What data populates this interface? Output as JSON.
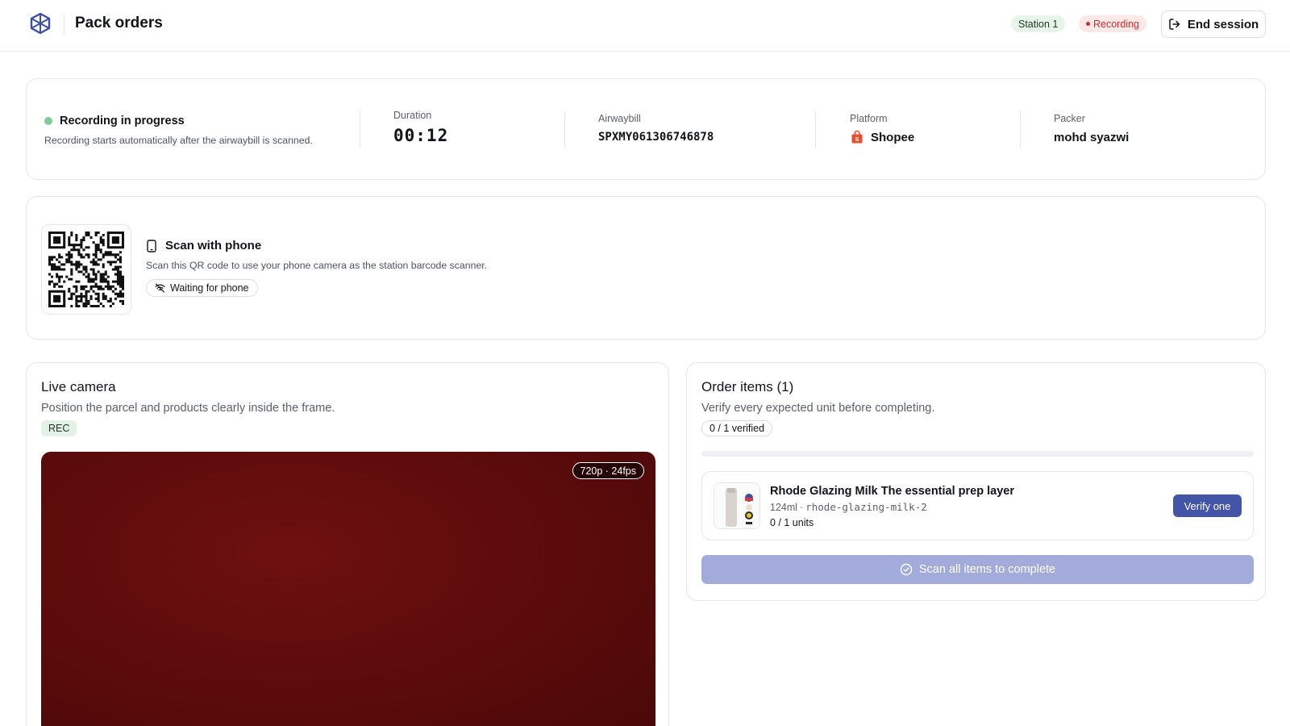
{
  "header": {
    "title": "Pack orders",
    "station_badge": "Station 1",
    "recording_badge": "Recording",
    "end_session_label": "End session"
  },
  "status": {
    "title": "Recording in progress",
    "subtitle": "Recording starts automatically after the airwaybill is scanned.",
    "duration_label": "Duration",
    "duration_value": "00:12",
    "airwaybill_label": "Airwaybill",
    "airwaybill_value": "SPXMY061306746878",
    "platform_label": "Platform",
    "platform_value": "Shopee",
    "packer_label": "Packer",
    "packer_value": "mohd syazwi"
  },
  "phone": {
    "title": "Scan with phone",
    "subtitle": "Scan this QR code to use your phone camera as the station barcode scanner.",
    "status": "Waiting for phone"
  },
  "camera": {
    "title": "Live camera",
    "subtitle": "Position the parcel and products clearly inside the frame.",
    "rec_tag": "REC",
    "resolution_badge": "720p · 24fps"
  },
  "order_items": {
    "title": "Order items (1)",
    "subtitle": "Verify every expected unit before completing.",
    "verified_label": "0 / 1 verified",
    "progress": 0,
    "items": [
      {
        "name": "Rhode Glazing Milk The essential prep layer",
        "size": "124ml",
        "sku": "rhode-glazing-milk-2",
        "units": "0 / 1 units",
        "action_label": "Verify one"
      }
    ],
    "complete_label": "Scan all items to complete"
  },
  "colors": {
    "accent": "#4455a8",
    "recording_red": "#d12b2b",
    "status_green": "#7fcc97",
    "shopee_orange": "#ee4d2d"
  }
}
